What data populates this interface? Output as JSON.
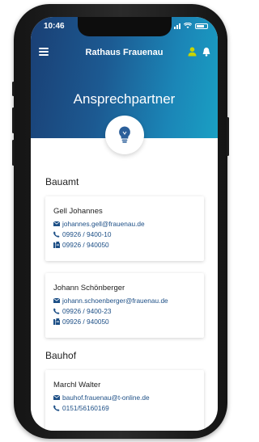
{
  "status_bar": {
    "time": "10:46"
  },
  "nav": {
    "title": "Rathaus Frauenau"
  },
  "page": {
    "title": "Ansprechpartner"
  },
  "sections": [
    {
      "title": "Bauamt",
      "contacts": [
        {
          "name": "Gell Johannes",
          "email": "johannes.gell@frauenau.de",
          "phone": "09926 / 9400-10",
          "fax": "09926 / 940050"
        },
        {
          "name": "Johann Schönberger",
          "email": "johann.schoenberger@frauenau.de",
          "phone": "09926 / 9400-23",
          "fax": "09926 / 940050"
        }
      ]
    },
    {
      "title": "Bauhof",
      "contacts": [
        {
          "name": "Marchl Walter",
          "email": "bauhof.frauenau@t-online.de",
          "phone": "0151/56160169"
        }
      ]
    }
  ],
  "colors": {
    "accent": "#1c5a92",
    "link": "#1d4f86",
    "user_icon": "#c8d400"
  },
  "icons": [
    "menu-icon",
    "user-icon",
    "bell-icon",
    "lightbulb-icon",
    "mail-icon",
    "phone-icon",
    "fax-icon"
  ]
}
